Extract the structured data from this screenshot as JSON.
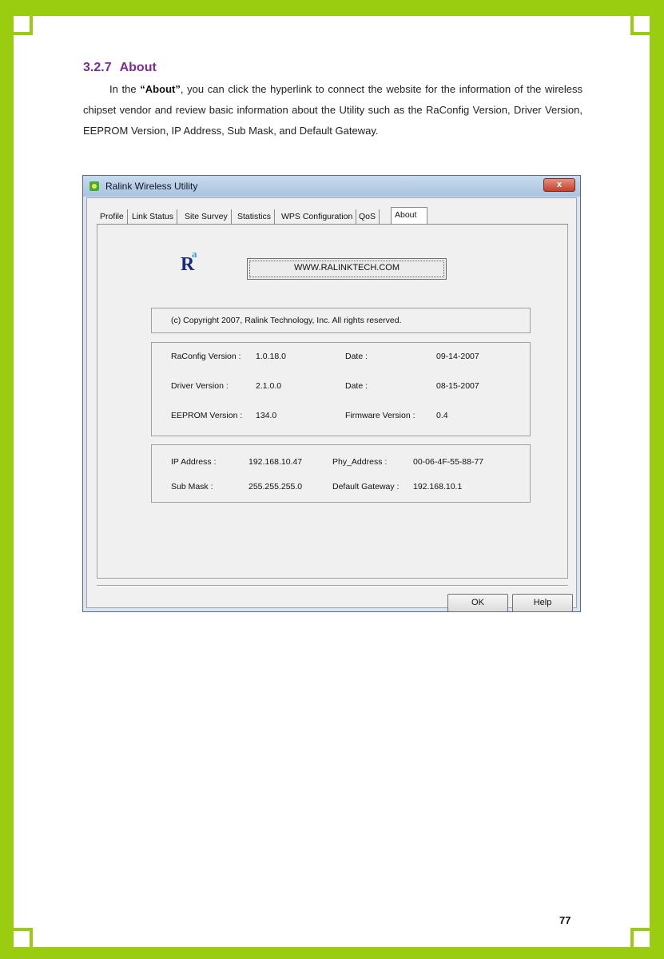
{
  "section": {
    "number": "3.2.7",
    "title": "About",
    "paragraph_before": "In the ",
    "paragraph_bold": "“About”",
    "paragraph_after": ", you can click the hyperlink to connect the website for the information of the wireless chipset vendor and review basic information about the Utility such as the RaConfig Version, Driver Version, EEPROM Version, IP Address, Sub Mask, and Default Gateway."
  },
  "window": {
    "title": "Ralink Wireless Utility",
    "close_label": "x",
    "tabs": [
      "Profile",
      "Link Status",
      "Site Survey",
      "Statistics",
      "WPS Configuration",
      "QoS",
      "About"
    ],
    "active_tab": "About",
    "logo_letter": "R",
    "logo_sup": "a",
    "website_button": "WWW.RALINKTECH.COM",
    "copyright": "(c) Copyright 2007, Ralink Technology, Inc.  All rights reserved.",
    "versions": {
      "raconfig_label": "RaConfig Version :",
      "raconfig_value": "1.0.18.0",
      "raconfig_date_label": "Date :",
      "raconfig_date": "09-14-2007",
      "driver_label": "Driver Version :",
      "driver_value": "2.1.0.0",
      "driver_date_label": "Date :",
      "driver_date": "08-15-2007",
      "eeprom_label": "EEPROM Version :",
      "eeprom_value": "134.0",
      "firmware_label": "Firmware Version :",
      "firmware_value": "0.4"
    },
    "network": {
      "ip_label": "IP Address :",
      "ip_value": "192.168.10.47",
      "phy_label": "Phy_Address :",
      "phy_value": "00-06-4F-55-88-77",
      "mask_label": "Sub Mask :",
      "mask_value": "255.255.255.0",
      "gateway_label": "Default Gateway :",
      "gateway_value": "192.168.10.1"
    },
    "ok_label": "OK",
    "help_label": "Help"
  },
  "page_number": "77",
  "colors": {
    "frame_green": "#9acd10",
    "heading_purple": "#7a2d90"
  }
}
